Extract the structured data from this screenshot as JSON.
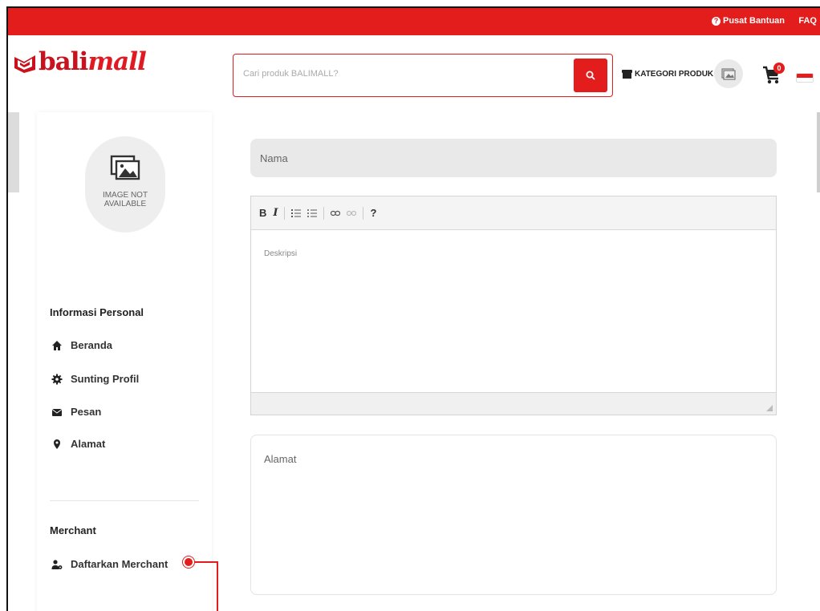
{
  "topbar": {
    "help_label": "Pusat Bantuan",
    "faq_label": "FAQ"
  },
  "header": {
    "logo_text_bold": "bali",
    "logo_text_script": "mall",
    "search_placeholder": "Cari produk BALIMALL?",
    "kategori_label": "KATEGORI PRODUK",
    "cart_count": "0"
  },
  "sidebar": {
    "avatar_text_line1": "IMAGE NOT",
    "avatar_text_line2": "AVAILABLE",
    "section_personal": "Informasi Personal",
    "items": [
      {
        "label": "Beranda",
        "icon": "home-icon"
      },
      {
        "label": "Sunting Profil",
        "icon": "gear-icon"
      },
      {
        "label": "Pesan",
        "icon": "envelope-icon"
      },
      {
        "label": "Alamat",
        "icon": "map-marker-icon"
      }
    ],
    "section_merchant": "Merchant",
    "merchant_item": {
      "label": "Daftarkan Merchant",
      "icon": "user-gear-icon"
    }
  },
  "form": {
    "nama_placeholder": "Nama",
    "deskripsi_placeholder": "Deskripsi",
    "alamat_placeholder": "Alamat",
    "toolbar": {
      "bold": "B",
      "italic": "I",
      "help": "?"
    }
  },
  "colors": {
    "brand_red": "#e31c1c",
    "input_gray": "#e9e9e9"
  }
}
